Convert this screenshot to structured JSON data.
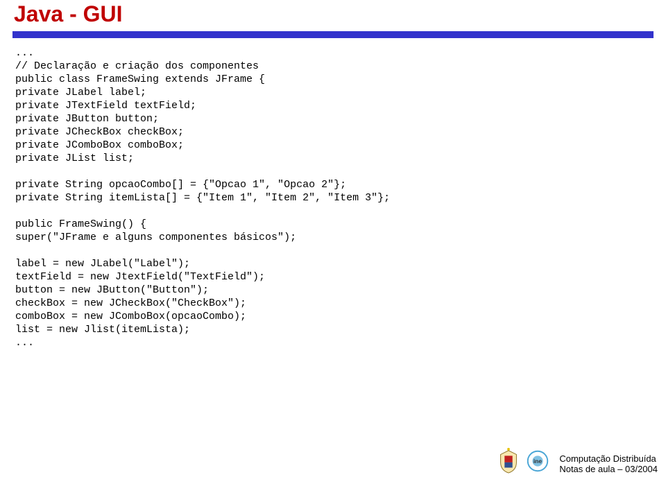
{
  "header": {
    "title": "Java - GUI"
  },
  "code": {
    "l01": "...",
    "l02": "// Declaração e criação dos componentes",
    "l03": "public class FrameSwing extends JFrame {",
    "l04": "private JLabel label;",
    "l05": "private JTextField textField;",
    "l06": "private JButton button;",
    "l07": "private JCheckBox checkBox;",
    "l08": "private JComboBox comboBox;",
    "l09": "private JList list;",
    "l10": "private String opcaoCombo[] = {\"Opcao 1\", \"Opcao 2\"};",
    "l11": "private String itemLista[] = {\"Item 1\", \"Item 2\", \"Item 3\"};",
    "l12": "public FrameSwing() {",
    "l13": "super(\"JFrame e alguns componentes básicos\");",
    "l14": "label = new JLabel(\"Label\");",
    "l15": "textField = new JtextField(\"TextField\");",
    "l16": "button = new JButton(\"Button\");",
    "l17": "checkBox = new JCheckBox(\"CheckBox\");",
    "l18": "comboBox = new JComboBox(opcaoCombo);",
    "l19": "list = new Jlist(itemLista);",
    "l20": "..."
  },
  "footer": {
    "line1": "Computação Distribuída",
    "line2": "Notas de aula  –  03/2004"
  }
}
